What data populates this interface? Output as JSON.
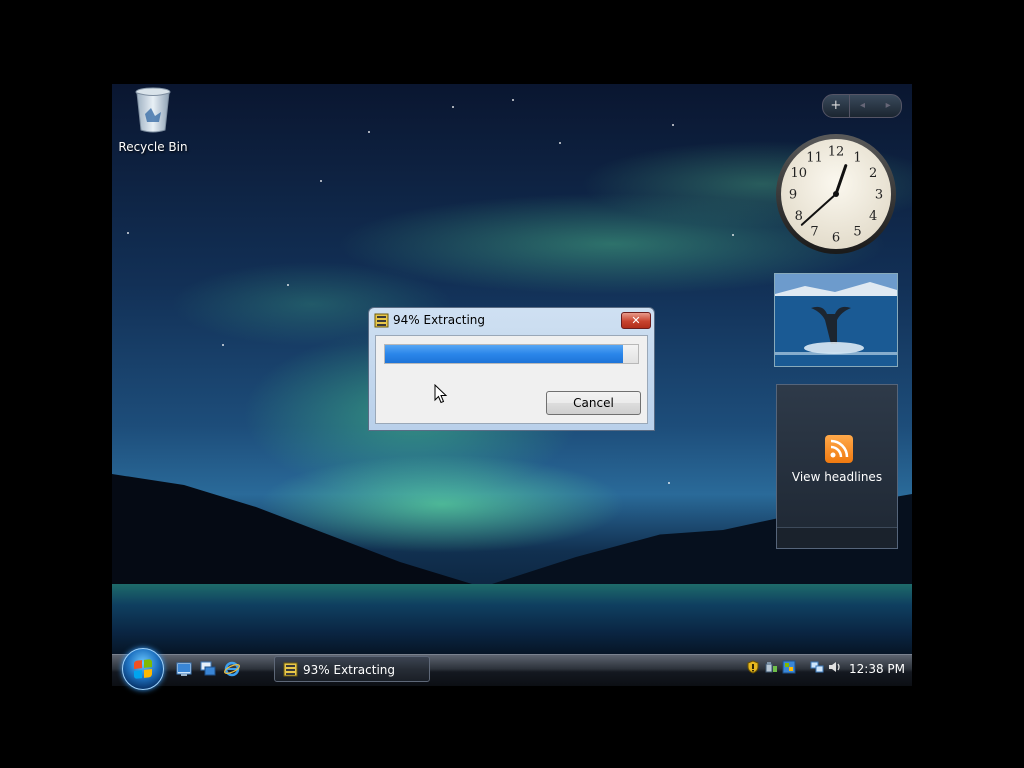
{
  "desktop": {
    "recycle_bin_label": "Recycle Bin"
  },
  "gadgets": {
    "add_symbol": "+",
    "prev_symbol": "◂",
    "next_symbol": "▸",
    "clock_numbers": [
      "12",
      "1",
      "2",
      "3",
      "4",
      "5",
      "6",
      "7",
      "8",
      "9",
      "10",
      "11"
    ],
    "clock_time": "12:38",
    "feed_label": "View headlines"
  },
  "dialog": {
    "title": "94% Extracting",
    "close_symbol": "✕",
    "progress": 0.94,
    "cancel_label": "Cancel"
  },
  "taskbar": {
    "task_label": "93% Extracting",
    "clock": "12:38 PM"
  },
  "colors": {
    "progress_fill": "#2b86ea",
    "rss_orange": "#f07a10",
    "close_red": "#c8432f"
  }
}
